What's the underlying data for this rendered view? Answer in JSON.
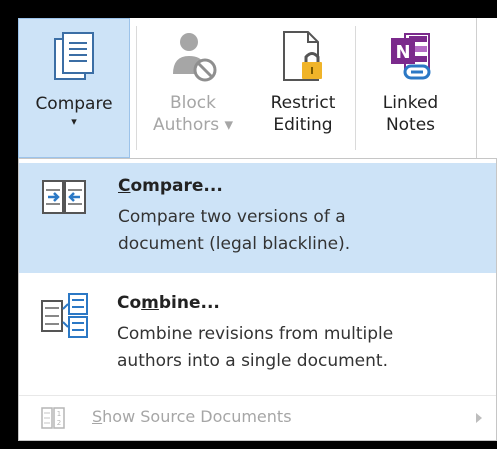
{
  "ribbon": {
    "buttons": [
      {
        "label_line1": "Compare",
        "label_line2": "▾",
        "icon": "compare-document-icon",
        "state": "pressed"
      },
      {
        "label_line1": "Block",
        "label_line2": "Authors ▾",
        "icon": "block-authors-icon",
        "state": "disabled"
      },
      {
        "label_line1": "Restrict",
        "label_line2": "Editing",
        "icon": "restrict-editing-icon",
        "state": "normal"
      },
      {
        "label_line1": "Linked",
        "label_line2": "Notes",
        "icon": "onenote-linked-notes-icon",
        "state": "normal"
      }
    ]
  },
  "menu": {
    "items": [
      {
        "title_accel": "C",
        "title_rest": "ompare...",
        "desc_line1": "Compare two versions of a",
        "desc_line2": "document (legal blackline).",
        "icon": "compare-arrows-icon",
        "highlighted": true
      },
      {
        "title_pre": "Co",
        "title_accel": "m",
        "title_rest": "bine...",
        "desc_line1": "Combine revisions from multiple",
        "desc_line2": "authors into a single document.",
        "icon": "combine-documents-icon"
      },
      {
        "title_accel": "S",
        "title_rest": "how Source Documents",
        "icon": "show-source-documents-icon",
        "disabled": true
      }
    ]
  },
  "colors": {
    "highlight": "#cde3f7",
    "accent": "#2b78c5",
    "onenote_purple": "#7b2a8c",
    "lock_gold": "#f0b429",
    "disabled_text": "#a6a6a6"
  }
}
